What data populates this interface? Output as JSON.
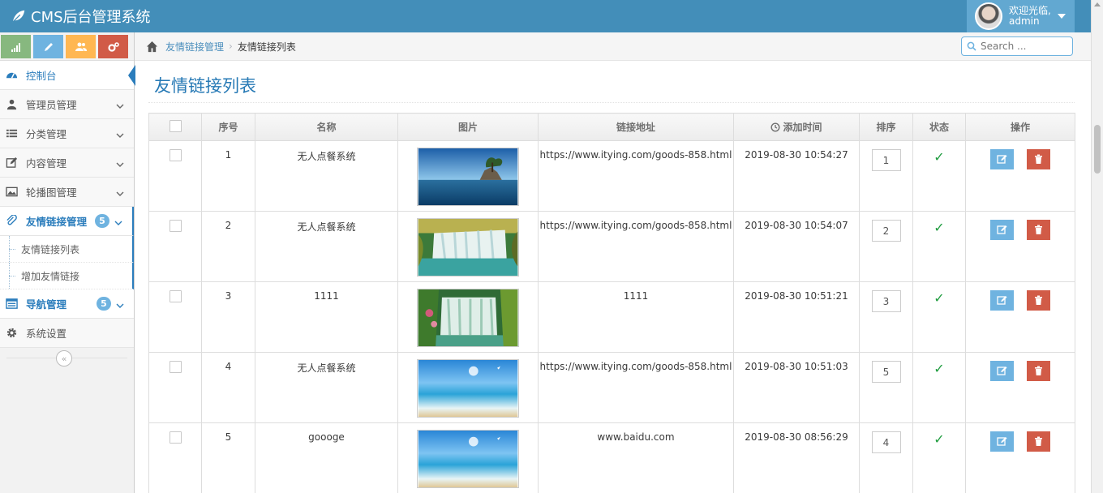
{
  "app": {
    "title": "CMS后台管理系统"
  },
  "user": {
    "greeting": "欢迎光临,",
    "name": "admin"
  },
  "shortcuts": [
    {
      "icon": "signal-icon",
      "color": "#87b87f"
    },
    {
      "icon": "pencil-icon",
      "color": "#6fb3e0"
    },
    {
      "icon": "users-icon",
      "color": "#ffb752"
    },
    {
      "icon": "cogs-icon",
      "color": "#d15b47"
    }
  ],
  "sidebar": {
    "items": [
      {
        "label": "控制台",
        "icon": "dashboard-icon"
      },
      {
        "label": "管理员管理",
        "icon": "user-icon"
      },
      {
        "label": "分类管理",
        "icon": "list-icon"
      },
      {
        "label": "内容管理",
        "icon": "edit-icon"
      },
      {
        "label": "轮播图管理",
        "icon": "picture-icon"
      },
      {
        "label": "友情链接管理",
        "icon": "link-icon",
        "badge": "5"
      },
      {
        "label": "导航管理",
        "icon": "desktop-icon",
        "badge": "5"
      },
      {
        "label": "系统设置",
        "icon": "gear-icon"
      }
    ],
    "subitems": [
      {
        "label": "友情链接列表"
      },
      {
        "label": "增加友情链接"
      }
    ],
    "collapse_glyph": "«"
  },
  "breadcrumb": {
    "parent": "友情链接管理",
    "current": "友情链接列表",
    "separator": "›"
  },
  "search": {
    "placeholder": "Search ..."
  },
  "page": {
    "title": "友情链接列表"
  },
  "table": {
    "columns": [
      "序号",
      "名称",
      "图片",
      "链接地址",
      "添加时间",
      "排序",
      "状态",
      "操作"
    ],
    "rows": [
      {
        "id": "1",
        "name": "无人点餐系统",
        "image": "island-photo",
        "url": "https://www.itying.com/goods-858.html",
        "time": "2019-08-30 10:54:27",
        "sort": "1",
        "status": "✓"
      },
      {
        "id": "2",
        "name": "无人点餐系统",
        "image": "waterfall-photo",
        "url": "https://www.itying.com/goods-858.html",
        "time": "2019-08-30 10:54:07",
        "sort": "2",
        "status": "✓"
      },
      {
        "id": "3",
        "name": "1111",
        "image": "waterfall-painting",
        "url": "1111",
        "time": "2019-08-30 10:51:21",
        "sort": "3",
        "status": "✓"
      },
      {
        "id": "4",
        "name": "无人点餐系统",
        "image": "beach-photo",
        "url": "https://www.itying.com/goods-858.html",
        "time": "2019-08-30 10:51:03",
        "sort": "5",
        "status": "✓"
      },
      {
        "id": "5",
        "name": "goooge",
        "image": "beach-photo",
        "url": "www.baidu.com",
        "time": "2019-08-30 08:56:29",
        "sort": "4",
        "status": "✓"
      }
    ]
  }
}
